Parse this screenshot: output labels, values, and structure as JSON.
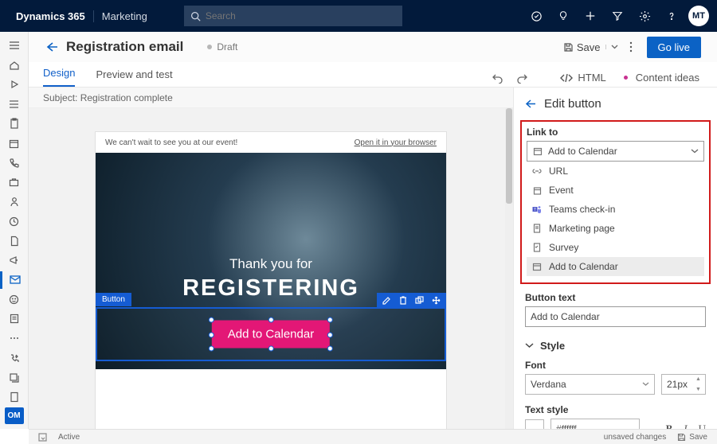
{
  "appbar": {
    "app_name": "Dynamics 365",
    "app_area": "Marketing",
    "search_placeholder": "Search",
    "avatar_initials": "MT"
  },
  "rail": {
    "area_badge": "OM"
  },
  "header": {
    "title": "Registration email",
    "status": "Draft",
    "save_label": "Save",
    "golive_label": "Go live"
  },
  "tabs": {
    "design": "Design",
    "preview": "Preview and test",
    "html_label": "HTML",
    "ideas_label": "Content ideas"
  },
  "subject": {
    "label": "Subject:",
    "value": "Registration complete"
  },
  "email": {
    "preheader": "We can't wait to see you at our event!",
    "open_browser": "Open it in your browser",
    "hero_line1": "Thank you for",
    "hero_line2": "REGISTERING",
    "element_tag": "Button",
    "cta_text": "Add to Calendar"
  },
  "panel": {
    "title": "Edit button",
    "link_to_label": "Link to",
    "combo_selected": "Add to Calendar",
    "options": {
      "url": "URL",
      "event": "Event",
      "teams": "Teams check-in",
      "marketing_page": "Marketing page",
      "survey": "Survey",
      "add_to_calendar": "Add to Calendar"
    },
    "button_text_label": "Button text",
    "button_text_value": "Add to Calendar",
    "style_label": "Style",
    "font_label": "Font",
    "font_value": "Verdana",
    "font_size": "21px",
    "text_style_label": "Text style",
    "hex_value": "#ffffff"
  },
  "statusbar": {
    "active": "Active",
    "unsaved": "unsaved changes",
    "save": "Save"
  }
}
